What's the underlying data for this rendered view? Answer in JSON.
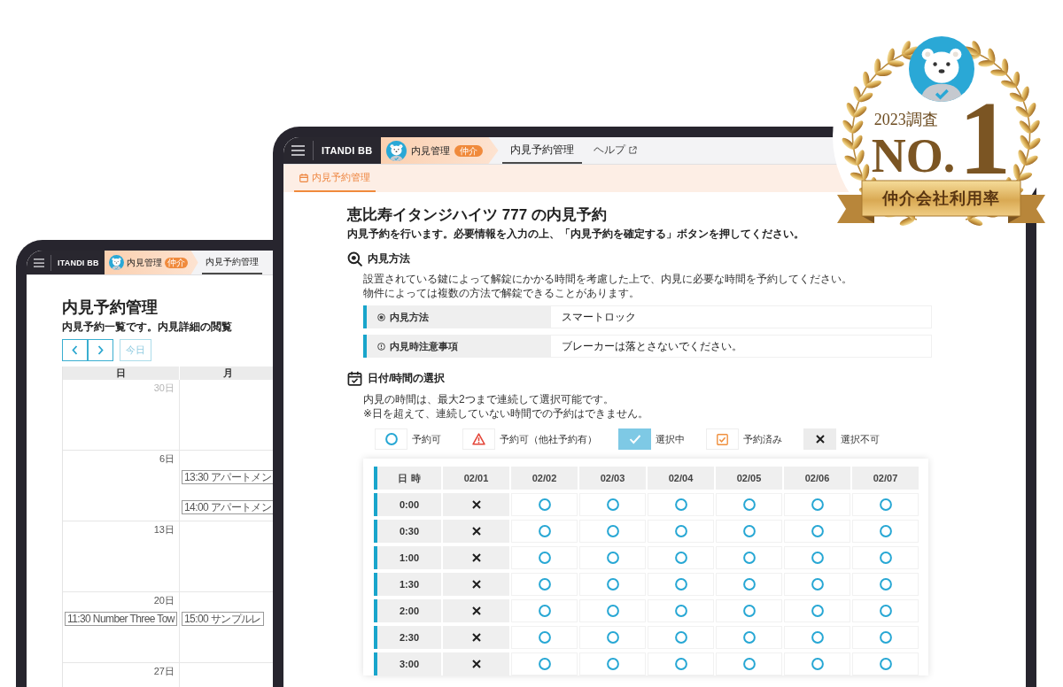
{
  "back_tablet": {
    "header": {
      "brand": "ITANDI BB",
      "app": {
        "name": "内見管理",
        "role": "仲介"
      },
      "tabs": [
        {
          "label": "内見予約管理",
          "selected": true,
          "external": false
        }
      ]
    },
    "page": {
      "title": "内見予約管理",
      "subtitle": "内見予約一覧です。内見詳細の閲覧",
      "today_button": {
        "label": "今日",
        "disabled": true
      }
    },
    "calendar": {
      "columns": [
        "日",
        "月"
      ],
      "weeks": [
        {
          "days": [
            {
              "date": "30日",
              "muted": true
            }
          ]
        },
        {
          "days": [
            {
              "date": "6日",
              "muted": false
            },
            {
              "events": [
                "13:30 アパートメン",
                "14:00 アパートメン"
              ]
            }
          ]
        },
        {
          "days": [
            {
              "date": "13日",
              "muted": false
            }
          ]
        },
        {
          "days": [
            {
              "date": "20日",
              "muted": false,
              "events": [
                "11:30 Number Three Tow"
              ]
            },
            {
              "events": [
                "15:00 サンプルレ"
              ]
            }
          ]
        },
        {
          "days": [
            {
              "date": "27日",
              "muted": false
            }
          ]
        }
      ]
    }
  },
  "front_tablet": {
    "header": {
      "brand": "ITANDI BB",
      "app": {
        "name": "内見管理",
        "role": "仲介"
      },
      "tabs": [
        {
          "label": "内見予約管理",
          "selected": true,
          "external": false
        },
        {
          "label": "ヘルプ",
          "selected": false,
          "external": true
        }
      ]
    },
    "subnav": {
      "tabs": [
        {
          "label": "内見予約管理",
          "selected": true
        }
      ]
    },
    "title": "恵比寿イタンジハイツ 777 の内見予約",
    "subtitle": "内見予約を行います。必要情報を入力の上、「内見予約を確定する」ボタンを押してください。",
    "method_section": {
      "heading": "内見方法",
      "description": [
        "設置されている鍵によって解錠にかかる時間を考慮した上で、内見に必要な時間を予約してください。",
        "物件によっては複数の方法で解錠できることがあります。"
      ],
      "fields": [
        {
          "kind": "method",
          "label": "内見方法",
          "value": "スマートロック"
        },
        {
          "kind": "notice",
          "label": "内見時注意事項",
          "value": "ブレーカーは落とさないでください。"
        }
      ]
    },
    "schedule_section": {
      "heading": "日付/時間の選択",
      "notes": [
        "内見の時間は、最大2つまで連続して選択可能です。",
        "※日を超えて、連続していない時間での予約はできません。"
      ],
      "legend": [
        {
          "kind": "available",
          "label": "予約可"
        },
        {
          "kind": "available_shared",
          "label": "予約可（他社予約有）"
        },
        {
          "kind": "selected",
          "label": "選択中"
        },
        {
          "kind": "booked",
          "label": "予約済み"
        },
        {
          "kind": "unavailable",
          "label": "選択不可"
        }
      ],
      "table": {
        "corner": "日 時",
        "dates": [
          "02/01",
          "02/02",
          "02/03",
          "02/04",
          "02/05",
          "02/06",
          "02/07"
        ],
        "rows": [
          {
            "time": "0:00",
            "slots": [
              {
                "kind": "unavailable"
              },
              {
                "kind": "available"
              },
              {
                "kind": "available"
              },
              {
                "kind": "available"
              },
              {
                "kind": "available"
              },
              {
                "kind": "available"
              },
              {
                "kind": "available"
              }
            ]
          },
          {
            "time": "0:30",
            "slots": [
              {
                "kind": "unavailable"
              },
              {
                "kind": "available"
              },
              {
                "kind": "available"
              },
              {
                "kind": "available"
              },
              {
                "kind": "available"
              },
              {
                "kind": "available"
              },
              {
                "kind": "available"
              }
            ]
          },
          {
            "time": "1:00",
            "slots": [
              {
                "kind": "unavailable"
              },
              {
                "kind": "available"
              },
              {
                "kind": "available"
              },
              {
                "kind": "available"
              },
              {
                "kind": "available"
              },
              {
                "kind": "available"
              },
              {
                "kind": "available"
              }
            ]
          },
          {
            "time": "1:30",
            "slots": [
              {
                "kind": "unavailable"
              },
              {
                "kind": "available"
              },
              {
                "kind": "available"
              },
              {
                "kind": "available"
              },
              {
                "kind": "available"
              },
              {
                "kind": "available"
              },
              {
                "kind": "available"
              }
            ]
          },
          {
            "time": "2:00",
            "slots": [
              {
                "kind": "unavailable"
              },
              {
                "kind": "available"
              },
              {
                "kind": "available"
              },
              {
                "kind": "available"
              },
              {
                "kind": "available"
              },
              {
                "kind": "available"
              },
              {
                "kind": "available"
              }
            ]
          },
          {
            "time": "2:30",
            "slots": [
              {
                "kind": "unavailable"
              },
              {
                "kind": "available"
              },
              {
                "kind": "available"
              },
              {
                "kind": "available"
              },
              {
                "kind": "available"
              },
              {
                "kind": "available"
              },
              {
                "kind": "available"
              }
            ]
          },
          {
            "time": "3:00",
            "slots": [
              {
                "kind": "unavailable"
              },
              {
                "kind": "available"
              },
              {
                "kind": "available"
              },
              {
                "kind": "available"
              },
              {
                "kind": "available"
              },
              {
                "kind": "available"
              },
              {
                "kind": "available"
              }
            ]
          }
        ]
      }
    }
  },
  "award": {
    "survey": "2023調査",
    "rank_prefix": "NO.",
    "rank_number": "1",
    "caption": "仲介会社利用率"
  }
}
